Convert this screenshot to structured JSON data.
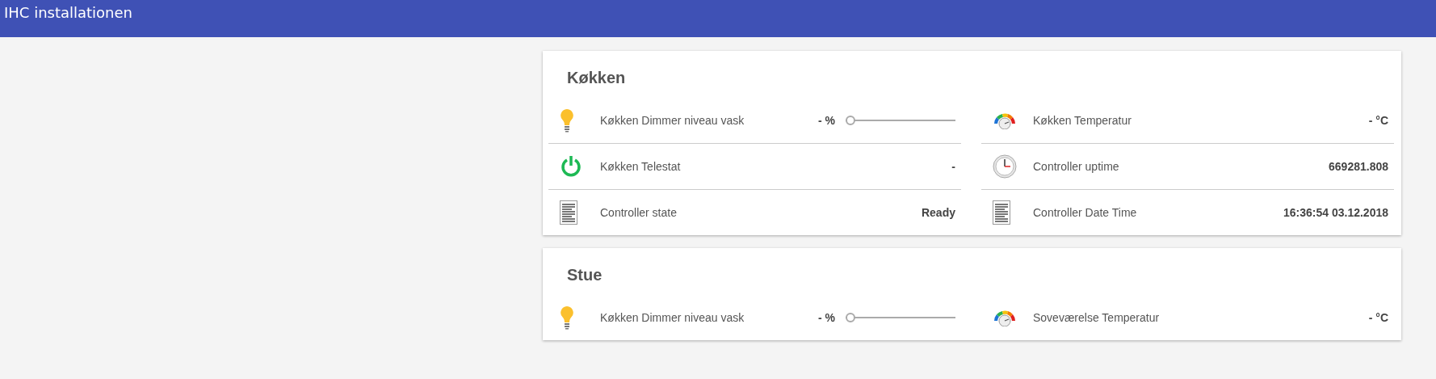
{
  "app_bar": {
    "title": "IHC installationen"
  },
  "cards": [
    {
      "title": "Køkken",
      "items": [
        {
          "kind": "dimmer",
          "label": "Køkken Dimmer niveau vask",
          "value": "- %",
          "level": 0
        },
        {
          "kind": "temperature",
          "label": "Køkken Temperatur",
          "value": "- °C"
        },
        {
          "kind": "switch",
          "label": "Køkken Telestat",
          "value": "-"
        },
        {
          "kind": "clock",
          "label": "Controller uptime",
          "value": "669281.808"
        },
        {
          "kind": "document",
          "label": "Controller state",
          "value": "Ready"
        },
        {
          "kind": "document",
          "label": "Controller Date Time",
          "value": "16:36:54 03.12.2018"
        }
      ]
    },
    {
      "title": "Stue",
      "items": [
        {
          "kind": "dimmer",
          "label": "Køkken Dimmer niveau vask",
          "value": "- %",
          "level": 0
        },
        {
          "kind": "temperature",
          "label": "Soveværelse Temperatur",
          "value": "- °C"
        }
      ]
    }
  ]
}
